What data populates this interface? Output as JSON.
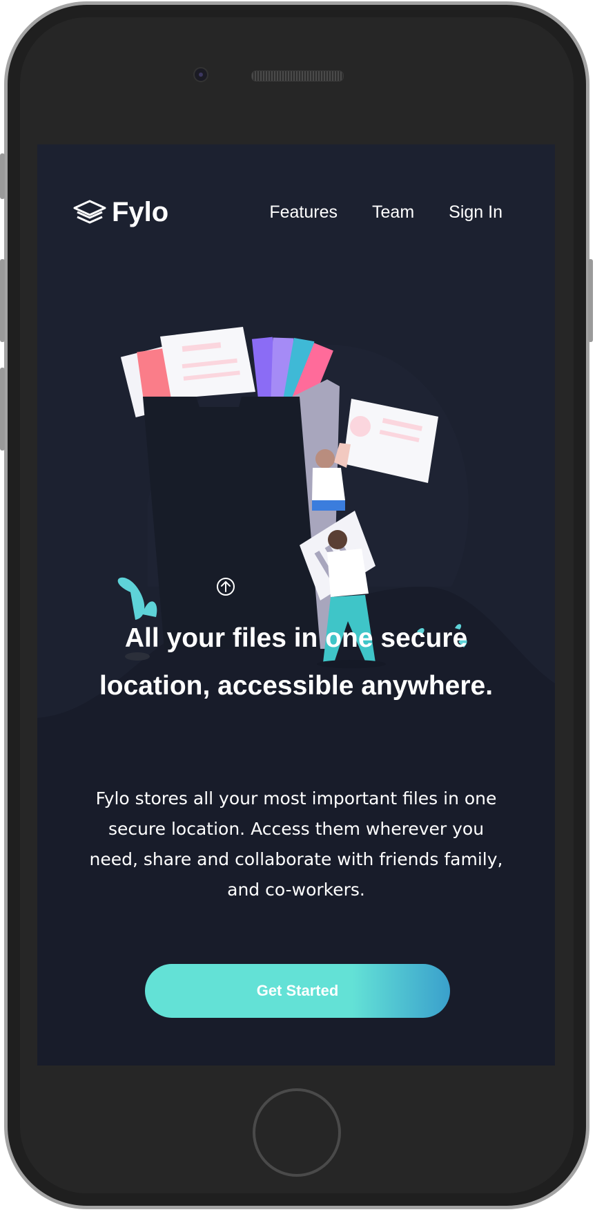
{
  "brand": {
    "name": "Fylo"
  },
  "nav": {
    "links": [
      "Features",
      "Team",
      "Sign In"
    ]
  },
  "hero": {
    "headline": "All your files in one secure location, accessible anywhere.",
    "description": "Fylo stores all your most important files in one secure location. Access them wherever you need, share and collaborate with friends family, and co-workers.",
    "cta_label": "Get Started"
  },
  "colors": {
    "background": "#1c2130",
    "accent_start": "#63e1d6",
    "accent_end": "#3aa0cc",
    "text": "#ffffff"
  },
  "icons": [
    "logo-layers-icon",
    "upload-arrow-icon"
  ]
}
